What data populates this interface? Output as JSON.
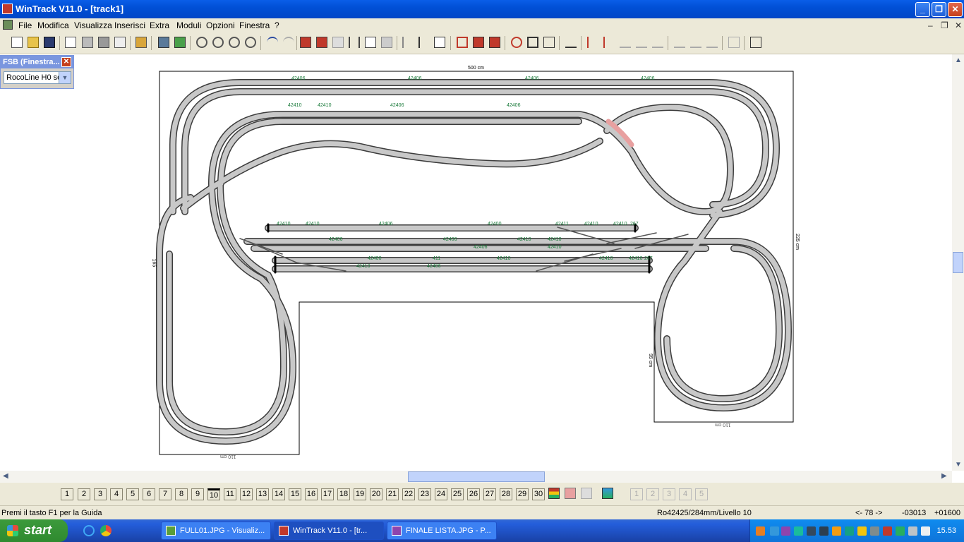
{
  "window": {
    "title": "WinTrack  V11.0 - [track1]",
    "btn_min": "_",
    "btn_max": "❐",
    "btn_close": "✕"
  },
  "menu": {
    "items": [
      "File",
      "Modifica",
      "Visualizza",
      "Inserisci",
      "Extra",
      "Moduli",
      "Opzioni",
      "Finestra",
      "?"
    ],
    "mdi_min": "–",
    "mdi_restore": "❐",
    "mdi_close": "✕"
  },
  "fsb": {
    "title": "FSB (Finestra...",
    "close": "✕",
    "selected": "RocoLine H0 se",
    "arrow": "▼"
  },
  "plan": {
    "dim_top": "500 cm",
    "dim_right": "225 cm",
    "dim_bottom_left": "110 cm",
    "dim_bottom_right": "110 cm",
    "dim_mid": "95 cm",
    "dim_left": "165",
    "labels_top": [
      "42406",
      "42406",
      "42406",
      "42406"
    ],
    "labels_second": [
      "42410",
      "42410",
      "42406",
      "42406"
    ],
    "labels_middle": [
      "42410",
      "42410",
      "42406",
      "42400",
      "42411",
      "42410",
      "42410",
      "267"
    ],
    "labels_lower": [
      "42406",
      "42406",
      "42406",
      "42410",
      "42410",
      "42410"
    ],
    "labels_bottom": [
      "42400",
      "411",
      "42410",
      "42410",
      "42406",
      "42410",
      "42410",
      "267"
    ]
  },
  "levels": {
    "items": [
      "1",
      "2",
      "3",
      "4",
      "5",
      "6",
      "7",
      "8",
      "9",
      "10",
      "11",
      "12",
      "13",
      "14",
      "15",
      "16",
      "17",
      "18",
      "19",
      "20",
      "21",
      "22",
      "23",
      "24",
      "25",
      "26",
      "27",
      "28",
      "29",
      "30"
    ],
    "extra": [
      "1",
      "2",
      "3",
      "4",
      "5"
    ]
  },
  "status": {
    "help": "Premi il tasto F1 per la Guida",
    "article": "Ro42425/284mm/Livello 10",
    "angle": "<- 78 ->",
    "x": "-03013",
    "y": "+01600"
  },
  "taskbar": {
    "start": "start",
    "tasks": [
      "FULL01.JPG - Visualiz...",
      "WinTrack  V11.0 - [tr...",
      "FINALE LISTA.JPG - P..."
    ],
    "clock": "15.53"
  },
  "colors": {
    "titlebar": "#0150d6",
    "track": "#c8c8c8",
    "rail": "#404040",
    "label": "#1a7a3a",
    "selected_track": "#e8a0a0"
  }
}
